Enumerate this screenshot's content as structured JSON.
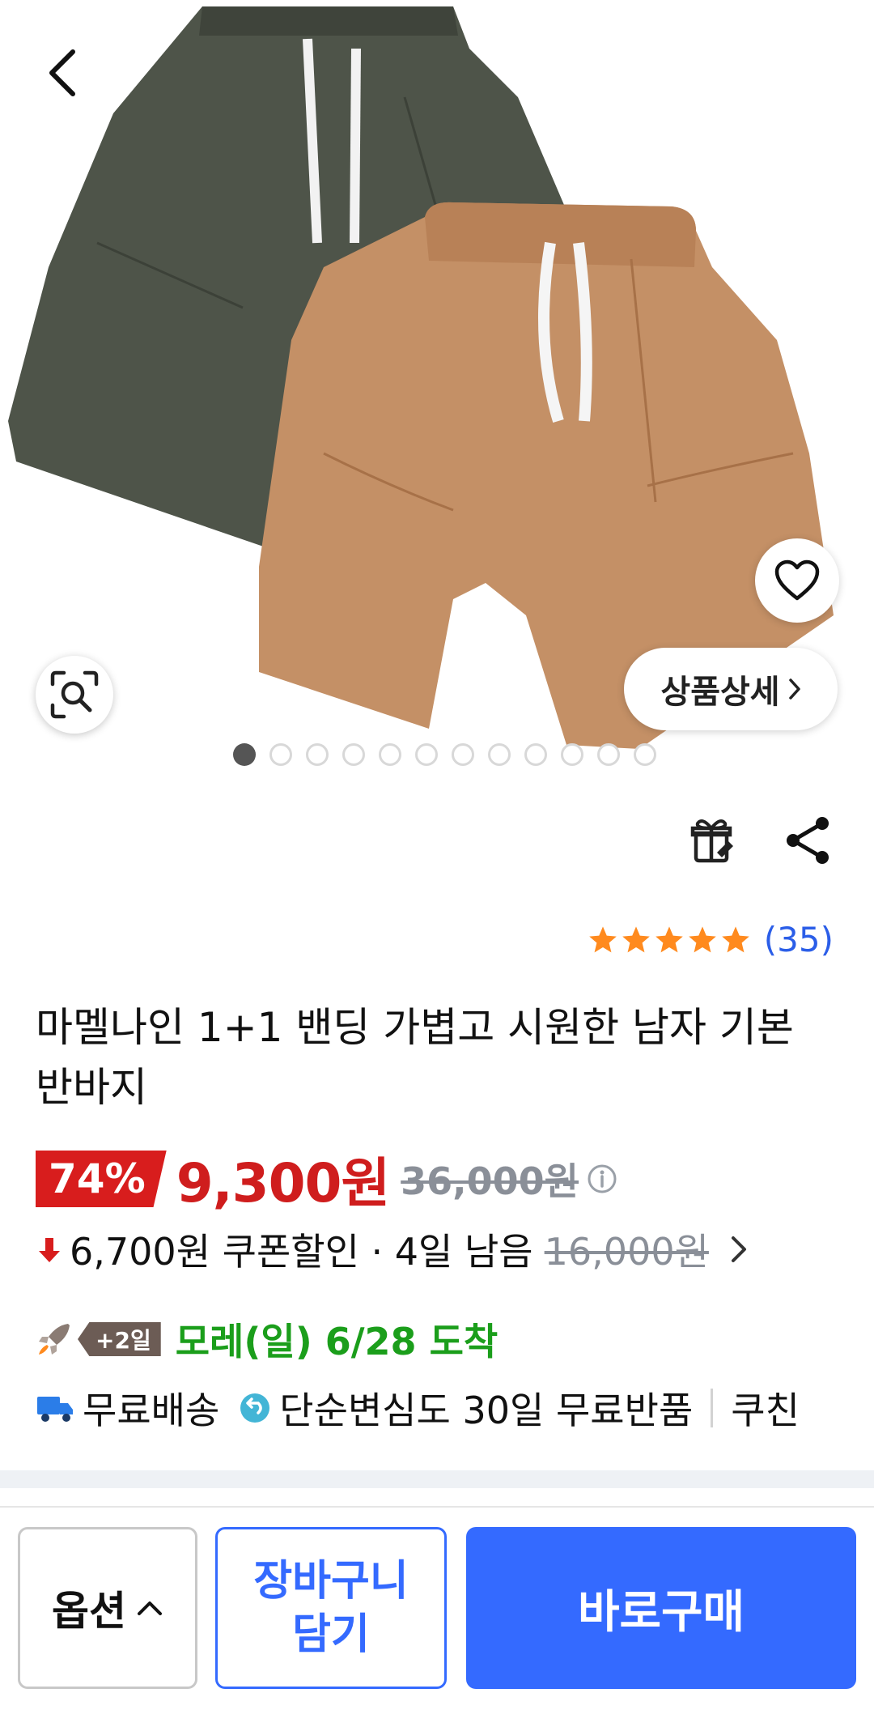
{
  "hero": {
    "detail_button_label": "상품상세",
    "slide_count": 12,
    "active_slide": 1
  },
  "rating": {
    "stars": 5,
    "review_count": "(35)",
    "star_color": "#ff8a1e"
  },
  "product": {
    "title": "마멜나인 1+1 밴딩 가볍고 시원한 남자 기본 반바지"
  },
  "price": {
    "discount_rate": "74%",
    "sale_price": "9,300원",
    "original_price": "36,000원"
  },
  "coupon": {
    "text": "6,700원 쿠폰할인 · 4일 남음",
    "strike_price": "16,000원"
  },
  "delivery": {
    "badge": "+2일",
    "arrival": "모레(일) 6/28 도착"
  },
  "benefits": {
    "free_shipping": "무료배송",
    "free_return": "단순변심도 30일 무료반품",
    "coupang_cash": "쿠친"
  },
  "bottom_bar": {
    "option_label": "옵션",
    "cart_line1": "장바구니",
    "cart_line2": "담기",
    "buy_label": "바로구매"
  },
  "colors": {
    "accent_blue": "#346aff",
    "discount_red": "#d81d1d",
    "arrival_green": "#1b9e1b"
  }
}
